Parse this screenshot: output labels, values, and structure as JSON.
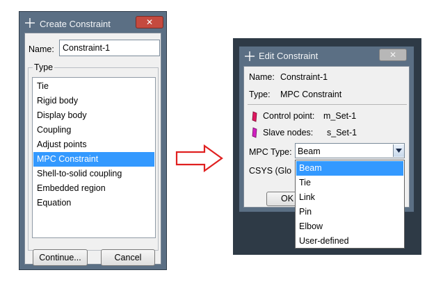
{
  "create_dialog": {
    "title": "Create Constraint",
    "close_label": "✕",
    "name_label": "Name:",
    "name_value": "Constraint-1",
    "type_legend": "Type",
    "types": [
      "Tie",
      "Rigid body",
      "Display body",
      "Coupling",
      "Adjust points",
      "MPC Constraint",
      "Shell-to-solid coupling",
      "Embedded region",
      "Equation"
    ],
    "selected_type_index": 5,
    "continue_label": "Continue...",
    "cancel_label": "Cancel"
  },
  "edit_dialog": {
    "title": "Edit Constraint",
    "close_label": "✕",
    "name_label": "Name:",
    "name_value": "Constraint-1",
    "type_label": "Type:",
    "type_value": "MPC Constraint",
    "control_point_label": "Control point:",
    "control_point_value": "m_Set-1",
    "slave_nodes_label": "Slave nodes:",
    "slave_nodes_value": "s_Set-1",
    "mpc_type_label": "MPC Type:",
    "mpc_type_value": "Beam",
    "csys_label": "CSYS (Glo",
    "ok_label": "OK",
    "mpc_type_options": [
      "Beam",
      "Tie",
      "Link",
      "Pin",
      "Elbow",
      "User-defined"
    ],
    "selected_option_index": 0
  },
  "colors": {
    "selection": "#3399ff",
    "window_frame": "#5b6f84",
    "arrow": "#e02020",
    "control_point_marker": "#e01860",
    "slave_nodes_marker": "#d020c0"
  }
}
